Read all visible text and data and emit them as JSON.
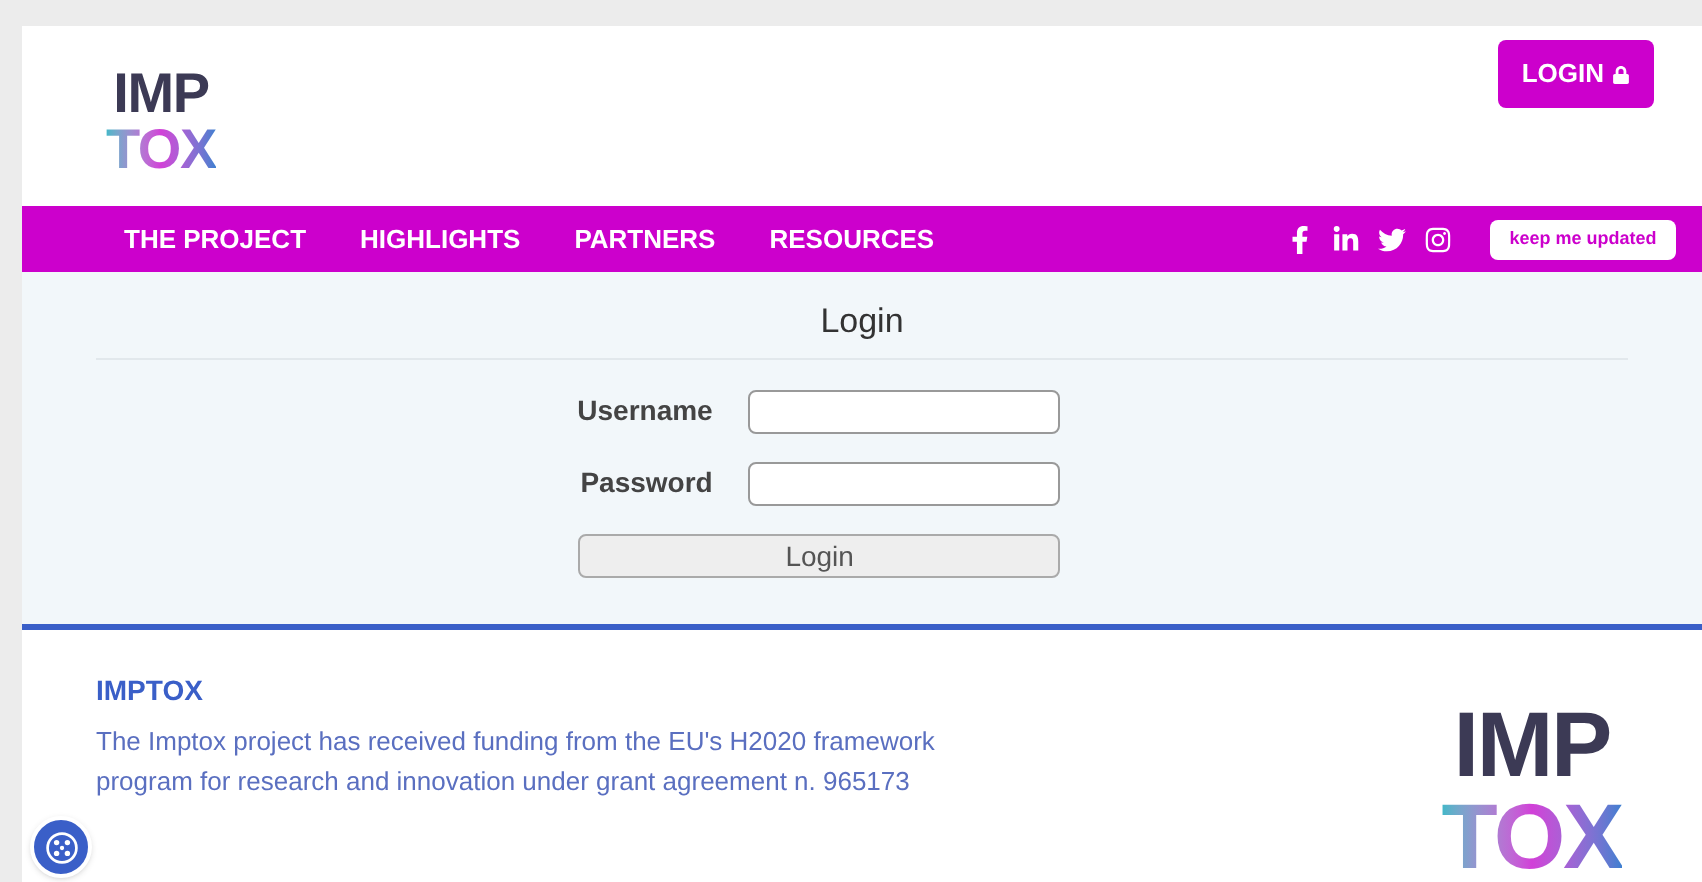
{
  "header": {
    "logo_top": "IMP",
    "logo_bottom": "TOX",
    "login_button": "LOGIN"
  },
  "nav": {
    "items": [
      {
        "label": "THE PROJECT"
      },
      {
        "label": "HIGHLIGHTS"
      },
      {
        "label": "PARTNERS"
      },
      {
        "label": "RESOURCES"
      }
    ],
    "subscribe_button": "keep me updated"
  },
  "login_form": {
    "title": "Login",
    "fields": [
      {
        "label": "Username"
      },
      {
        "label": "Password"
      }
    ],
    "submit": "Login"
  },
  "footer": {
    "heading": "IMPTOX",
    "text": "The Imptox project has received funding from the EU's H2020 framework program for research and innovation under grant agreement n. 965173",
    "logo_top": "IMP",
    "logo_bottom": "TOX"
  }
}
